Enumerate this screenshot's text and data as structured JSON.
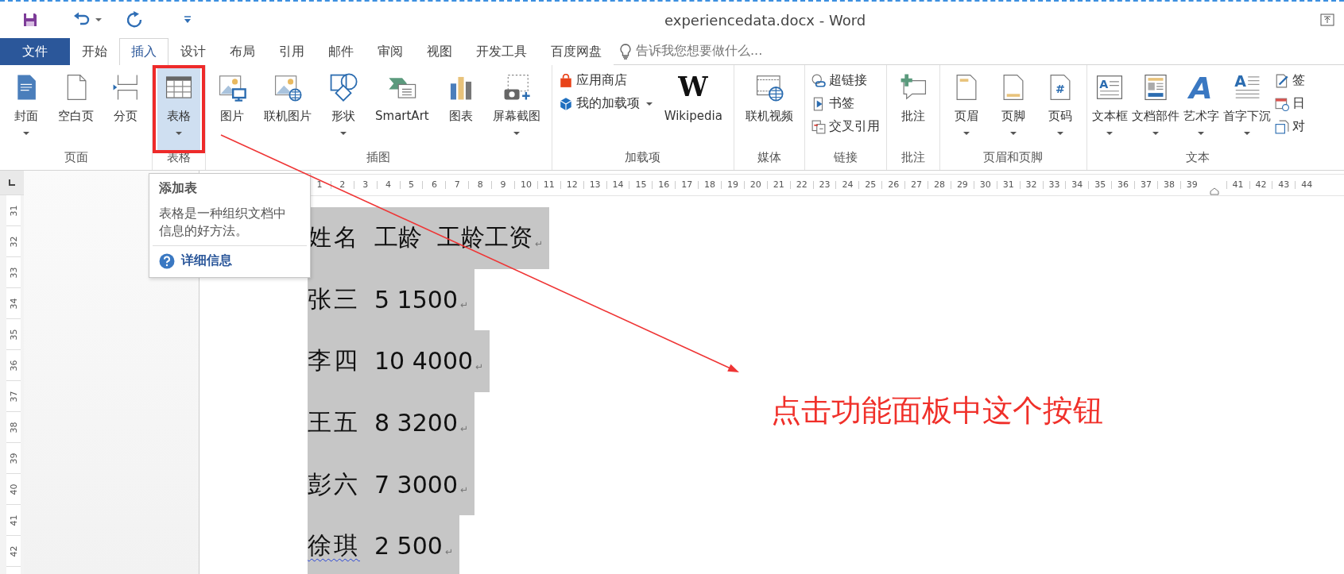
{
  "window": {
    "title": "experiencedata.docx - Word"
  },
  "tabs": [
    {
      "label": "文件",
      "kind": "file",
      "selected": false
    },
    {
      "label": "开始",
      "kind": "tab",
      "selected": false
    },
    {
      "label": "插入",
      "kind": "tab",
      "selected": true
    },
    {
      "label": "设计",
      "kind": "tab",
      "selected": false
    },
    {
      "label": "布局",
      "kind": "tab",
      "selected": false
    },
    {
      "label": "引用",
      "kind": "tab",
      "selected": false
    },
    {
      "label": "邮件",
      "kind": "tab",
      "selected": false
    },
    {
      "label": "审阅",
      "kind": "tab",
      "selected": false
    },
    {
      "label": "视图",
      "kind": "tab",
      "selected": false
    },
    {
      "label": "开发工具",
      "kind": "tab",
      "selected": false
    },
    {
      "label": "百度网盘",
      "kind": "tab",
      "selected": false
    }
  ],
  "tell_me": {
    "placeholder": "告诉我您想要做什么..."
  },
  "ribbon": {
    "groups": [
      {
        "label": "页面",
        "items": [
          {
            "label": "封面",
            "kind": "large",
            "menu": true,
            "hovered": false
          },
          {
            "label": "空白页",
            "kind": "large",
            "menu": false,
            "hovered": false
          },
          {
            "label": "分页",
            "kind": "large",
            "menu": false,
            "hovered": false
          }
        ]
      },
      {
        "label": "表格",
        "items": [
          {
            "label": "表格",
            "kind": "large",
            "menu": true,
            "hovered": true
          }
        ]
      },
      {
        "label": "插图",
        "items": [
          {
            "label": "图片",
            "kind": "large",
            "menu": false,
            "hovered": false
          },
          {
            "label": "联机图片",
            "kind": "large",
            "menu": false,
            "hovered": false
          },
          {
            "label": "形状",
            "kind": "large",
            "menu": true,
            "hovered": false
          },
          {
            "label": "SmartArt",
            "kind": "large",
            "menu": false,
            "hovered": false
          },
          {
            "label": "图表",
            "kind": "large",
            "menu": false,
            "hovered": false
          },
          {
            "label": "屏幕截图",
            "kind": "large",
            "menu": true,
            "hovered": false
          }
        ]
      },
      {
        "label": "加载项",
        "items": [
          {
            "label": "应用商店",
            "kind": "small",
            "menu": false,
            "hovered": false
          },
          {
            "label": "我的加载项",
            "kind": "small",
            "menu": true,
            "hovered": false
          },
          {
            "label": "Wikipedia",
            "kind": "large",
            "menu": false,
            "hovered": false,
            "icon_text": "W"
          }
        ]
      },
      {
        "label": "媒体",
        "items": [
          {
            "label": "联机视频",
            "kind": "large",
            "menu": false,
            "hovered": false
          }
        ]
      },
      {
        "label": "链接",
        "items": [
          {
            "label": "超链接",
            "kind": "small",
            "menu": false,
            "hovered": false
          },
          {
            "label": "书签",
            "kind": "small",
            "menu": false,
            "hovered": false
          },
          {
            "label": "交叉引用",
            "kind": "small",
            "menu": false,
            "hovered": false
          }
        ]
      },
      {
        "label": "批注",
        "items": [
          {
            "label": "批注",
            "kind": "large",
            "menu": false,
            "hovered": false
          }
        ]
      },
      {
        "label": "页眉和页脚",
        "items": [
          {
            "label": "页眉",
            "kind": "large",
            "menu": true,
            "hovered": false
          },
          {
            "label": "页脚",
            "kind": "large",
            "menu": true,
            "hovered": false
          },
          {
            "label": "页码",
            "kind": "large",
            "menu": true,
            "hovered": false,
            "icon_text": "#"
          }
        ]
      },
      {
        "label": "文本",
        "items": [
          {
            "label": "文本框",
            "kind": "large",
            "menu": true,
            "hovered": false,
            "icon_text": "A"
          },
          {
            "label": "文档部件",
            "kind": "large",
            "menu": true,
            "hovered": false
          },
          {
            "label": "艺术字",
            "kind": "large",
            "menu": true,
            "hovered": false,
            "icon_text": "A"
          },
          {
            "label": "首字下沉",
            "kind": "large",
            "menu": true,
            "hovered": false,
            "icon_text": "A"
          },
          {
            "label": "签",
            "kind": "small",
            "menu": false,
            "hovered": false
          },
          {
            "label": "日",
            "kind": "small",
            "menu": false,
            "hovered": false
          },
          {
            "label": "对",
            "kind": "small",
            "menu": false,
            "hovered": false
          }
        ]
      }
    ]
  },
  "tooltip": {
    "title": "添加表",
    "description": "表格是一种组织文档中信息的好方法。",
    "link": "详细信息"
  },
  "ruler": {
    "numbers": [
      "1",
      "2",
      "3",
      "4",
      "5",
      "6",
      "7",
      "8",
      "9",
      "10",
      "11",
      "12",
      "13",
      "14",
      "15",
      "16",
      "17",
      "18",
      "19",
      "20",
      "21",
      "22",
      "23",
      "24",
      "25",
      "26",
      "27",
      "28",
      "29",
      "30",
      "31",
      "32",
      "33",
      "34",
      "35",
      "36",
      "37",
      "38",
      "39"
    ],
    "numbers_after_indent": [
      "41",
      "42",
      "43",
      "44"
    ]
  },
  "vertical_ruler": {
    "numbers": [
      "31",
      "32",
      "33",
      "34",
      "35",
      "36",
      "37",
      "38",
      "39",
      "40",
      "41",
      "42"
    ]
  },
  "document": {
    "lines": [
      {
        "name": "姓名",
        "figures": "工龄  工龄工资",
        "end_mark": "↵",
        "misspelled": false
      },
      {
        "name": "张三",
        "figures": "5 1500",
        "end_mark": "↵",
        "misspelled": false
      },
      {
        "name": "李四",
        "figures": "10 4000",
        "end_mark": "↵",
        "misspelled": false
      },
      {
        "name": "王五",
        "figures": "8 3200",
        "end_mark": "↵",
        "misspelled": false
      },
      {
        "name": "彭六",
        "figures": "7 3000",
        "end_mark": "↵",
        "misspelled": false
      },
      {
        "name": "徐琪",
        "figures": "2 500",
        "end_mark": "↵",
        "misspelled": true
      }
    ]
  },
  "annotation": {
    "note": "点击功能面板中这个按钮"
  }
}
